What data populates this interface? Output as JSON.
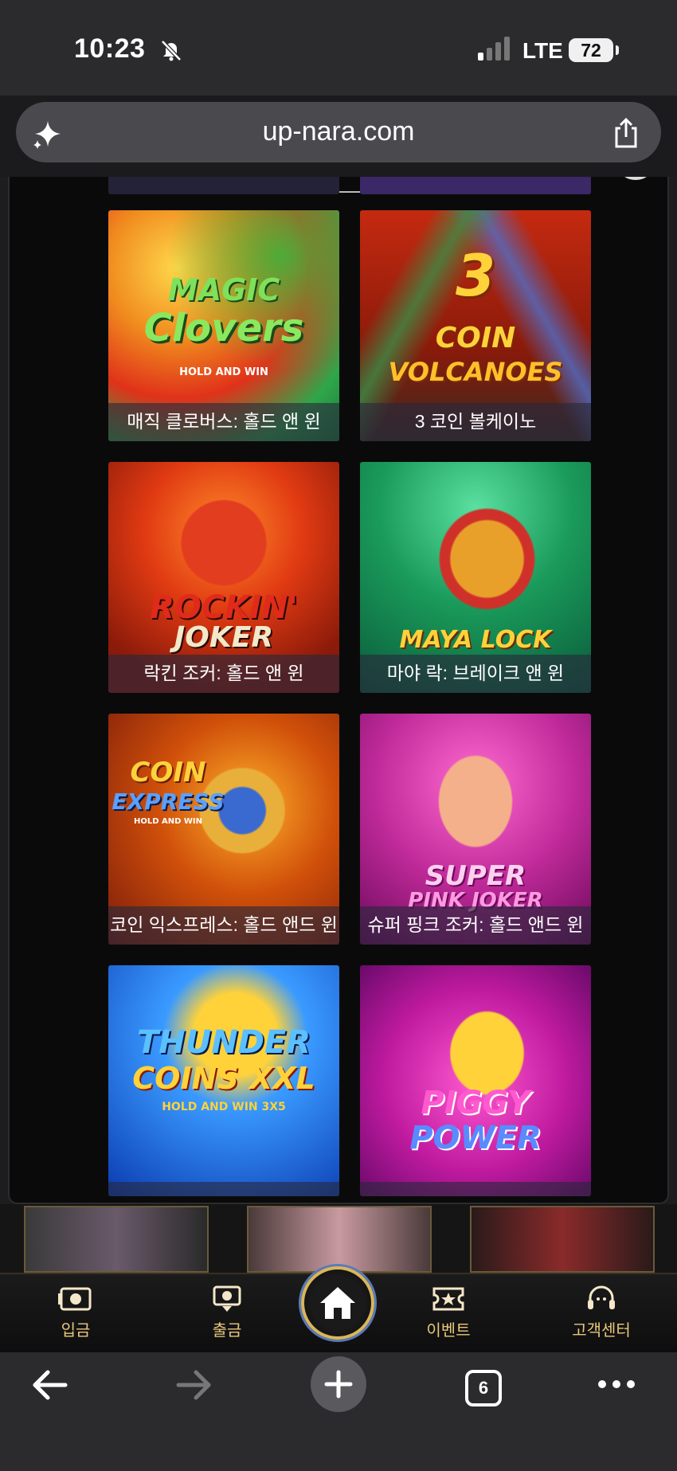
{
  "status_bar": {
    "time": "10:23",
    "network": "LTE",
    "battery": "72"
  },
  "browser": {
    "url": "up-nara.com",
    "tab_count": "6"
  },
  "games": [
    {
      "name": "매직 클로버스: 홀드 앤 윈",
      "logo_line1": "MAGIC",
      "logo_line2": "Clovers",
      "logo_line3": "HOLD AND WIN"
    },
    {
      "name": "3 코인 볼케이노",
      "logo_line1": "3",
      "logo_line2": "COIN",
      "logo_line3": "VOLCANOES"
    },
    {
      "name": "락킨 조커: 홀드 앤 윈",
      "logo_line1": "ROCKIN'",
      "logo_line2": "JOKER"
    },
    {
      "name": "마야 락: 브레이크 앤 윈",
      "logo_line1": "MAYA LOCK"
    },
    {
      "name": "코인 익스프레스: 홀드 앤드 윈",
      "logo_line1": "COIN",
      "logo_line2": "EXPRESS",
      "logo_line3": "HOLD AND WIN"
    },
    {
      "name": "슈퍼 핑크 조커: 홀드 앤드 윈",
      "logo_line1": "SUPER",
      "logo_line2": "PINK JOKER"
    },
    {
      "name": "",
      "logo_line1": "THUNDER",
      "logo_line2": "COINS XXL",
      "logo_line3": "HOLD AND WIN 3X5"
    },
    {
      "name": "",
      "logo_line1": "PIGGY",
      "logo_line2": "POWER"
    }
  ],
  "site_nav": {
    "deposit": "입금",
    "withdraw": "출금",
    "event": "이벤트",
    "support": "고객센터"
  },
  "colors": {
    "accent_gold": "#e8c77a",
    "toolbar": "#2b2b2e"
  }
}
